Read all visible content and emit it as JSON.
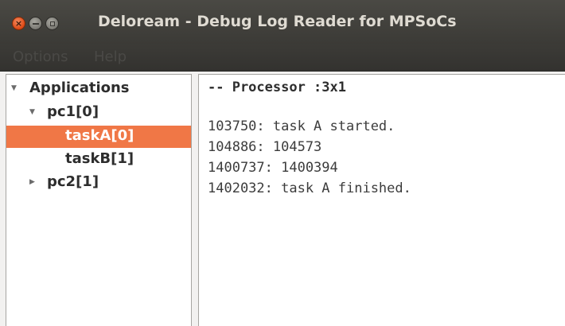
{
  "window": {
    "title": "Deloream - Debug Log Reader for MPSoCs"
  },
  "titlebar_buttons": {
    "close_glyph": "×"
  },
  "menu": {
    "items": [
      "Options",
      "Help"
    ]
  },
  "tree": {
    "root": {
      "label": "Applications",
      "expanded": true,
      "icon": "arrow-down-icon"
    },
    "nodes": [
      {
        "label": "pc1[0]",
        "expanded": true,
        "icon": "arrow-down-icon"
      },
      {
        "label": "taskA[0]",
        "selected": true
      },
      {
        "label": "taskB[1]"
      },
      {
        "label": "pc2[1]",
        "expanded": false,
        "icon": "arrow-right-icon"
      }
    ],
    "glyphs": {
      "expanded": "▼",
      "collapsed": "▶"
    }
  },
  "log": {
    "header": "-- Processor :3x1",
    "lines": [
      "103750: task A started.",
      "104886: 104573",
      "1400737: 1400394",
      "1402032: task A finished."
    ]
  },
  "colors": {
    "titlebar": "#3c3b37",
    "selection": "#f07746",
    "close_button": "#dd4814"
  }
}
